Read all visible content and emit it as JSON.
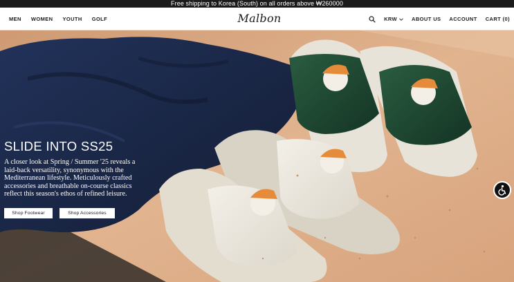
{
  "promo": {
    "text": "Free shipping to Korea (South) on all orders above ₩260000"
  },
  "header": {
    "nav_left": [
      "MEN",
      "WOMEN",
      "YOUTH",
      "GOLF"
    ],
    "logo": "Malbon",
    "currency": "KRW",
    "nav_right": {
      "about": "ABOUT US",
      "account": "ACCOUNT",
      "cart": "CART (0)"
    },
    "icons": {
      "search": "search-icon",
      "currency_dropdown": "chevron-down-icon"
    }
  },
  "hero": {
    "title": "SLIDE INTO SS25",
    "body": "A closer look at Spring / Summer '25 reveals a laid-back versatility, synonymous with the Mediterranean lifestyle. Meticulously crafted accessories and breathable on-course classics reflect this season's ethos of refined leisure.",
    "buttons": {
      "footwear": "Shop Footwear",
      "accessories": "Shop Accessories"
    }
  },
  "accessibility": {
    "icon": "accessibility-icon"
  },
  "colors": {
    "promo_bg": "#1b1b1b",
    "sand": "#d9a47e",
    "shirt_navy": "#1c2a4a",
    "slide_green": "#1f4a33",
    "slide_cream": "#ece8df"
  }
}
